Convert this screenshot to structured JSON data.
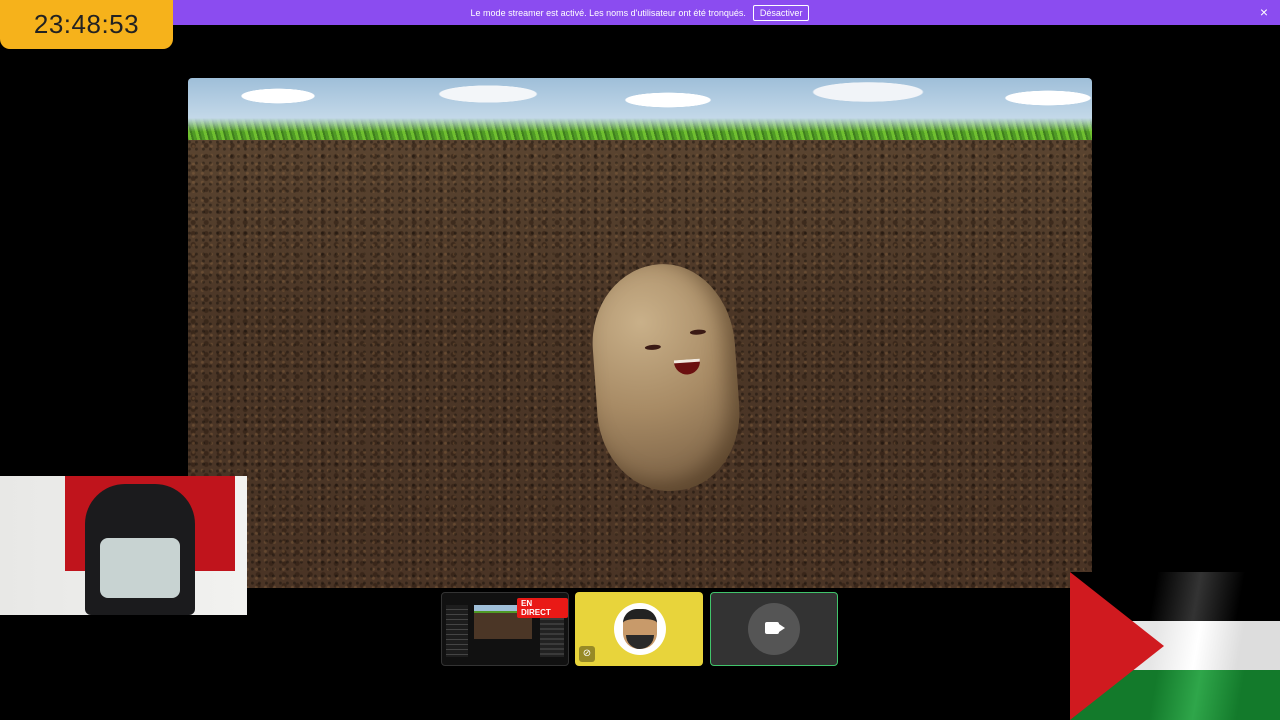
{
  "banner": {
    "message": "Le mode streamer est activé. Les noms d'utilisateur ont été tronqués.",
    "disable_label": "Désactiver",
    "close_icon": "×"
  },
  "clock": {
    "time": "23:48:53"
  },
  "tiles": {
    "screen_share": {
      "live_label": "EN DIRECT"
    },
    "avatar": {
      "mic_icon": "mic-muted-icon",
      "mic_glyph": "⊘"
    },
    "camera": {
      "icon": "camera-off-icon"
    }
  },
  "colors": {
    "banner": "#8b4cf0",
    "clock": "#f6b21b",
    "live": "#e91916",
    "avatar_tile": "#e8d43b",
    "active_speaker_border": "#41c46b"
  }
}
